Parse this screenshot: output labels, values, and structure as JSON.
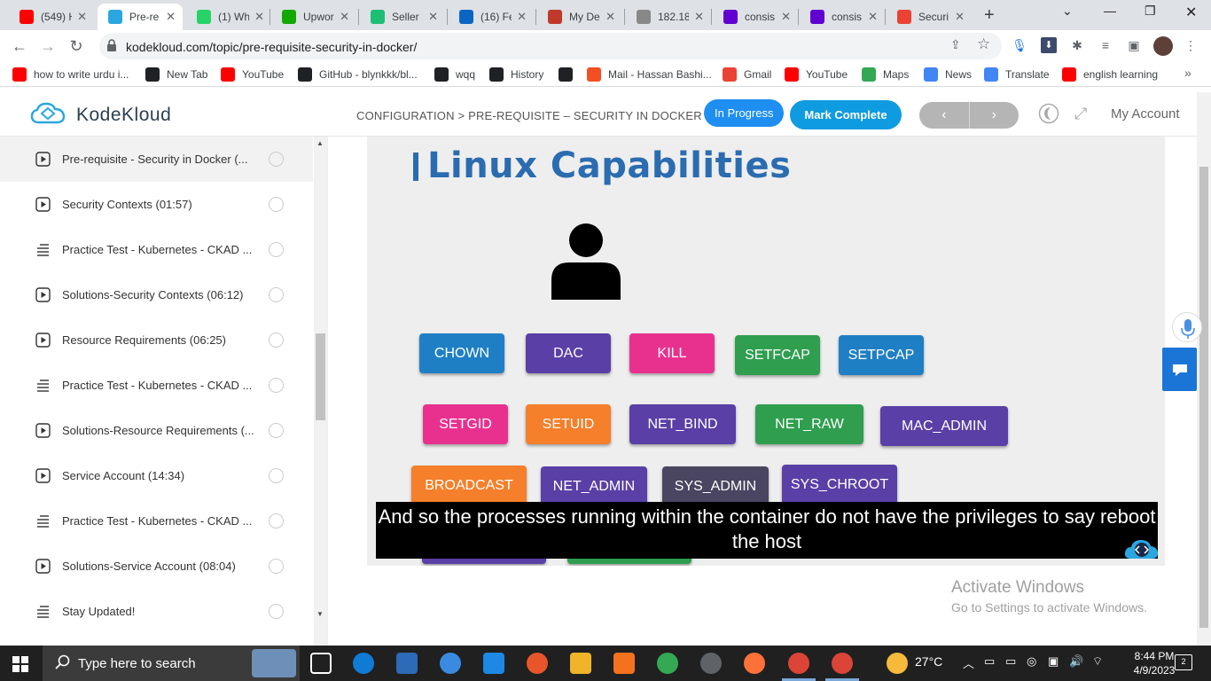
{
  "browser": {
    "tabs": [
      {
        "label": "(549) H",
        "icon": "youtube-icon",
        "color": "#ff0000"
      },
      {
        "label": "Pre-re",
        "icon": "kodekloud-icon",
        "color": "#2aa7e0",
        "active": true
      },
      {
        "label": "(1) Wh",
        "icon": "whatsapp-icon",
        "color": "#25d366"
      },
      {
        "label": "Upwor",
        "icon": "upwork-icon",
        "color": "#14a800"
      },
      {
        "label": "Seller",
        "icon": "fiverr-icon",
        "color": "#1dbf73"
      },
      {
        "label": "(16) Fe",
        "icon": "linkedin-icon",
        "color": "#0a66c2"
      },
      {
        "label": "My De",
        "icon": "site-icon",
        "color": "#c0392b"
      },
      {
        "label": "182.18",
        "icon": "globe-icon",
        "color": "#888888"
      },
      {
        "label": "consis",
        "icon": "yahoo-icon",
        "color": "#6001d2"
      },
      {
        "label": "consis",
        "icon": "yahoo-icon",
        "color": "#6001d2"
      },
      {
        "label": "Securi",
        "icon": "gmail-icon",
        "color": "#ea4335"
      }
    ],
    "url": "kodekloud.com/topic/pre-requisite-security-in-docker/",
    "bookmarks": [
      {
        "label": "how to write urdu i...",
        "icon": "youtube-icon",
        "color": "#ff0000"
      },
      {
        "label": "New Tab",
        "icon": "globe-icon",
        "color": "#202124"
      },
      {
        "label": "YouTube",
        "icon": "youtube-icon",
        "color": "#ff0000"
      },
      {
        "label": "GitHub - blynkkk/bl...",
        "icon": "github-icon",
        "color": "#202124"
      },
      {
        "label": "wqq",
        "icon": "download-icon",
        "color": "#202124"
      },
      {
        "label": "History",
        "icon": "history-icon",
        "color": "#202124"
      },
      {
        "label": "",
        "icon": "globe-icon",
        "color": "#202124"
      },
      {
        "label": "Mail - Hassan Bashi...",
        "icon": "microsoft-icon",
        "color": "#f25022"
      },
      {
        "label": "Gmail",
        "icon": "gmail-icon",
        "color": "#ea4335"
      },
      {
        "label": "YouTube",
        "icon": "youtube-icon",
        "color": "#ff0000"
      },
      {
        "label": "Maps",
        "icon": "maps-icon",
        "color": "#34a853"
      },
      {
        "label": "News",
        "icon": "news-icon",
        "color": "#4285f4"
      },
      {
        "label": "Translate",
        "icon": "translate-icon",
        "color": "#4285f4"
      },
      {
        "label": "english learning",
        "icon": "youtube-icon",
        "color": "#ff0000"
      }
    ]
  },
  "header": {
    "brand": "KodeKloud",
    "breadcrumb": "CONFIGURATION > PRE-REQUISITE – SECURITY IN DOCKER",
    "status": "In Progress",
    "mark_complete": "Mark Complete",
    "prev": "‹",
    "next": "›",
    "account": "My Account"
  },
  "sidebar": {
    "items": [
      {
        "label": "Pre-requisite - Security in Docker (...",
        "type": "video",
        "active": true
      },
      {
        "label": "Security Contexts (01:57)",
        "type": "video"
      },
      {
        "label": "Practice Test - Kubernetes - CKAD ...",
        "type": "text"
      },
      {
        "label": "Solutions-Security Contexts (06:12)",
        "type": "video"
      },
      {
        "label": "Resource Requirements (06:25)",
        "type": "video"
      },
      {
        "label": "Practice Test - Kubernetes - CKAD ...",
        "type": "text"
      },
      {
        "label": "Solutions-Resource Requirements (...",
        "type": "video"
      },
      {
        "label": "Service Account (14:34)",
        "type": "video"
      },
      {
        "label": "Practice Test - Kubernetes - CKAD ...",
        "type": "text"
      },
      {
        "label": "Solutions-Service Account (08:04)",
        "type": "video"
      },
      {
        "label": "Stay Updated!",
        "type": "text"
      }
    ]
  },
  "video": {
    "slide_title": "Linux Capabilities",
    "capabilities": [
      {
        "label": "CHOWN",
        "color": "#1f7fc4"
      },
      {
        "label": "DAC",
        "color": "#5a3fa6"
      },
      {
        "label": "KILL",
        "color": "#e8318f"
      },
      {
        "label": "SETFCAP",
        "color": "#2f9e4f"
      },
      {
        "label": "SETPCAP",
        "color": "#1f7fc4"
      },
      {
        "label": "SETGID",
        "color": "#e8318f"
      },
      {
        "label": "SETUID",
        "color": "#f57f2a"
      },
      {
        "label": "NET_BIND",
        "color": "#5a3fa6"
      },
      {
        "label": "NET_RAW",
        "color": "#2f9e4f"
      },
      {
        "label": "MAC_ADMIN",
        "color": "#5a3fa6"
      },
      {
        "label": "BROADCAST",
        "color": "#f57f2a"
      },
      {
        "label": "NET_ADMIN",
        "color": "#5a3fa6"
      },
      {
        "label": "SYS_ADMIN",
        "color": "#4a4560"
      },
      {
        "label": "SYS_CHROOT",
        "color": "#5a3fa6"
      }
    ],
    "subtitle": "And so the processes running within the container do not have the privileges to say reboot the host"
  },
  "watermark": {
    "line1": "Activate Windows",
    "line2": "Go to Settings to activate Windows."
  },
  "taskbar": {
    "search_placeholder": "Type here to search",
    "weather": "27°C",
    "time": "8:44 PM",
    "date": "4/9/2023",
    "notifications": "2"
  }
}
